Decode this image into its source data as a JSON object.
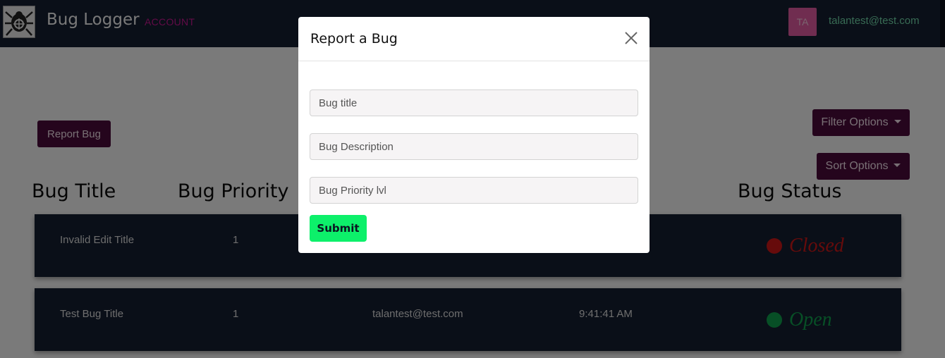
{
  "navbar": {
    "brand": "Bug Logger",
    "account_link": "ACCOUNT",
    "avatar_initials": "TA",
    "user_email": "talantest@test.com"
  },
  "toolbar": {
    "report_bug": "Report Bug",
    "filter_options": "Filter Options",
    "sort_options": "Sort Options"
  },
  "table": {
    "columns": [
      "Bug Title",
      "Bug Priority",
      "",
      "",
      "Bug Status"
    ],
    "rows": [
      {
        "title": "Invalid Edit Title",
        "priority": "1",
        "reporter": "",
        "time": "",
        "status": "Closed",
        "status_color": "#cc1717"
      },
      {
        "title": "Test Bug Title",
        "priority": "1",
        "reporter": "talantest@test.com",
        "time": "9:41:41 AM",
        "status": "Open",
        "status_color": "#0f9f4c"
      }
    ]
  },
  "modal": {
    "title": "Report a Bug",
    "fields": {
      "title_placeholder": "Bug title",
      "description_placeholder": "Bug Description",
      "priority_placeholder": "Bug Priority lvl"
    },
    "submit": "Submit"
  },
  "colors": {
    "navbar_bg": "#141e30",
    "button_bg": "#4a0a3a",
    "submit_bg": "#0df06a",
    "account_link": "#c5168f"
  }
}
